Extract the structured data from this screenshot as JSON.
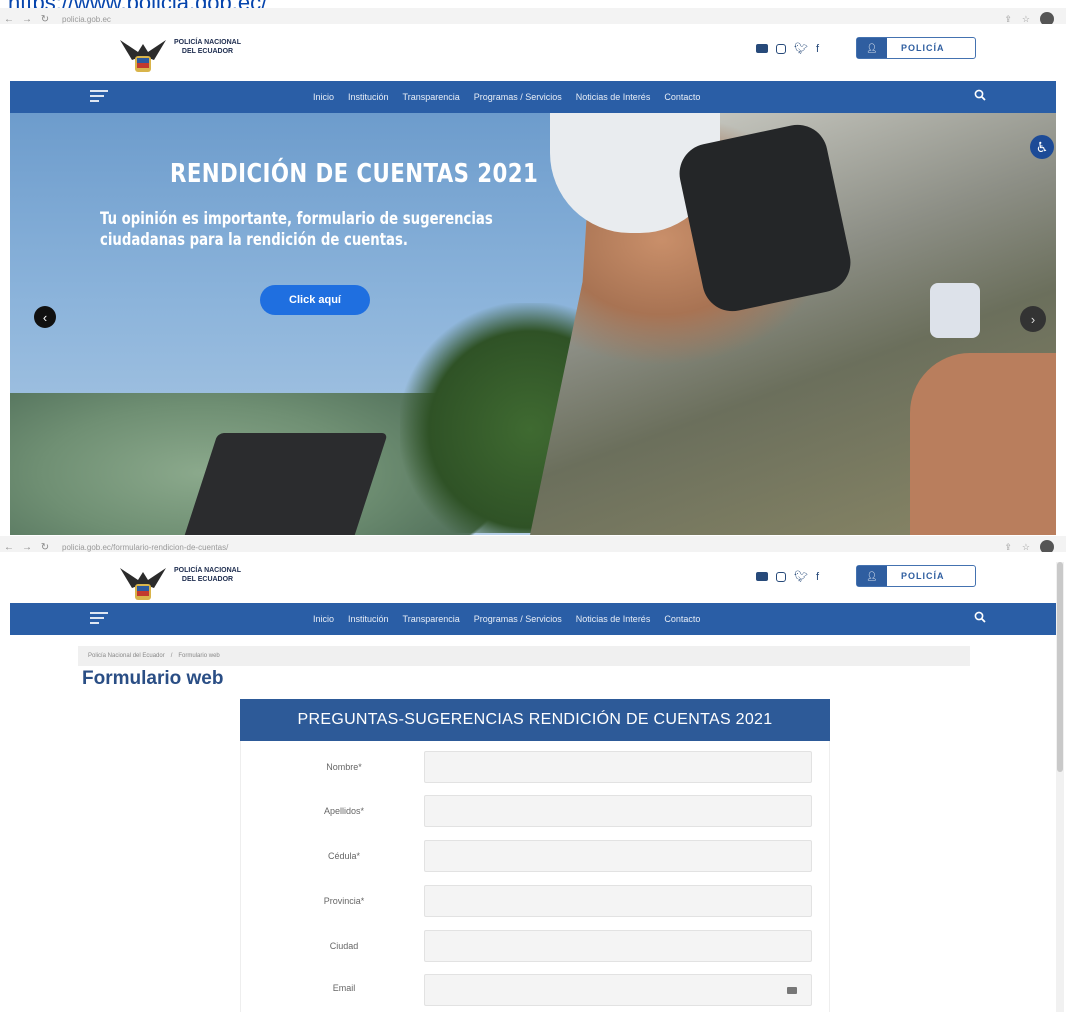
{
  "url_link": "https://www.policia.gob.ec/",
  "browser1": {
    "address": "policia.gob.ec"
  },
  "browser2": {
    "address": "policia.gob.ec/formulario-rendicion-de-cuentas/"
  },
  "header": {
    "logo_text_line1": "POLICÍA NACIONAL",
    "logo_text_line2": "DEL ECUADOR",
    "policia_button": "POLICÍA"
  },
  "nav": {
    "items": [
      "Inicio",
      "Institución",
      "Transparencia",
      "Programas / Servicios",
      "Noticias de Interés",
      "Contacto"
    ]
  },
  "hero": {
    "title": "RENDICIÓN DE CUENTAS 2021",
    "subtitle": "Tu opinión es importante, formulario de sugerencias ciudadanas para la rendición de cuentas.",
    "button": "Click aquí"
  },
  "breadcrumb": {
    "home": "Policía Nacional del Ecuador",
    "current": "Formulario web"
  },
  "page_title": "Formulario web",
  "form": {
    "heading": "PREGUNTAS-SUGERENCIAS  RENDICIÓN DE CUENTAS  2021",
    "fields": [
      {
        "label": "Nombre*"
      },
      {
        "label": "Apellidos*"
      },
      {
        "label": "Cédula*"
      },
      {
        "label": "Provincia*"
      },
      {
        "label": "Ciudad"
      },
      {
        "label": "Email"
      }
    ]
  }
}
